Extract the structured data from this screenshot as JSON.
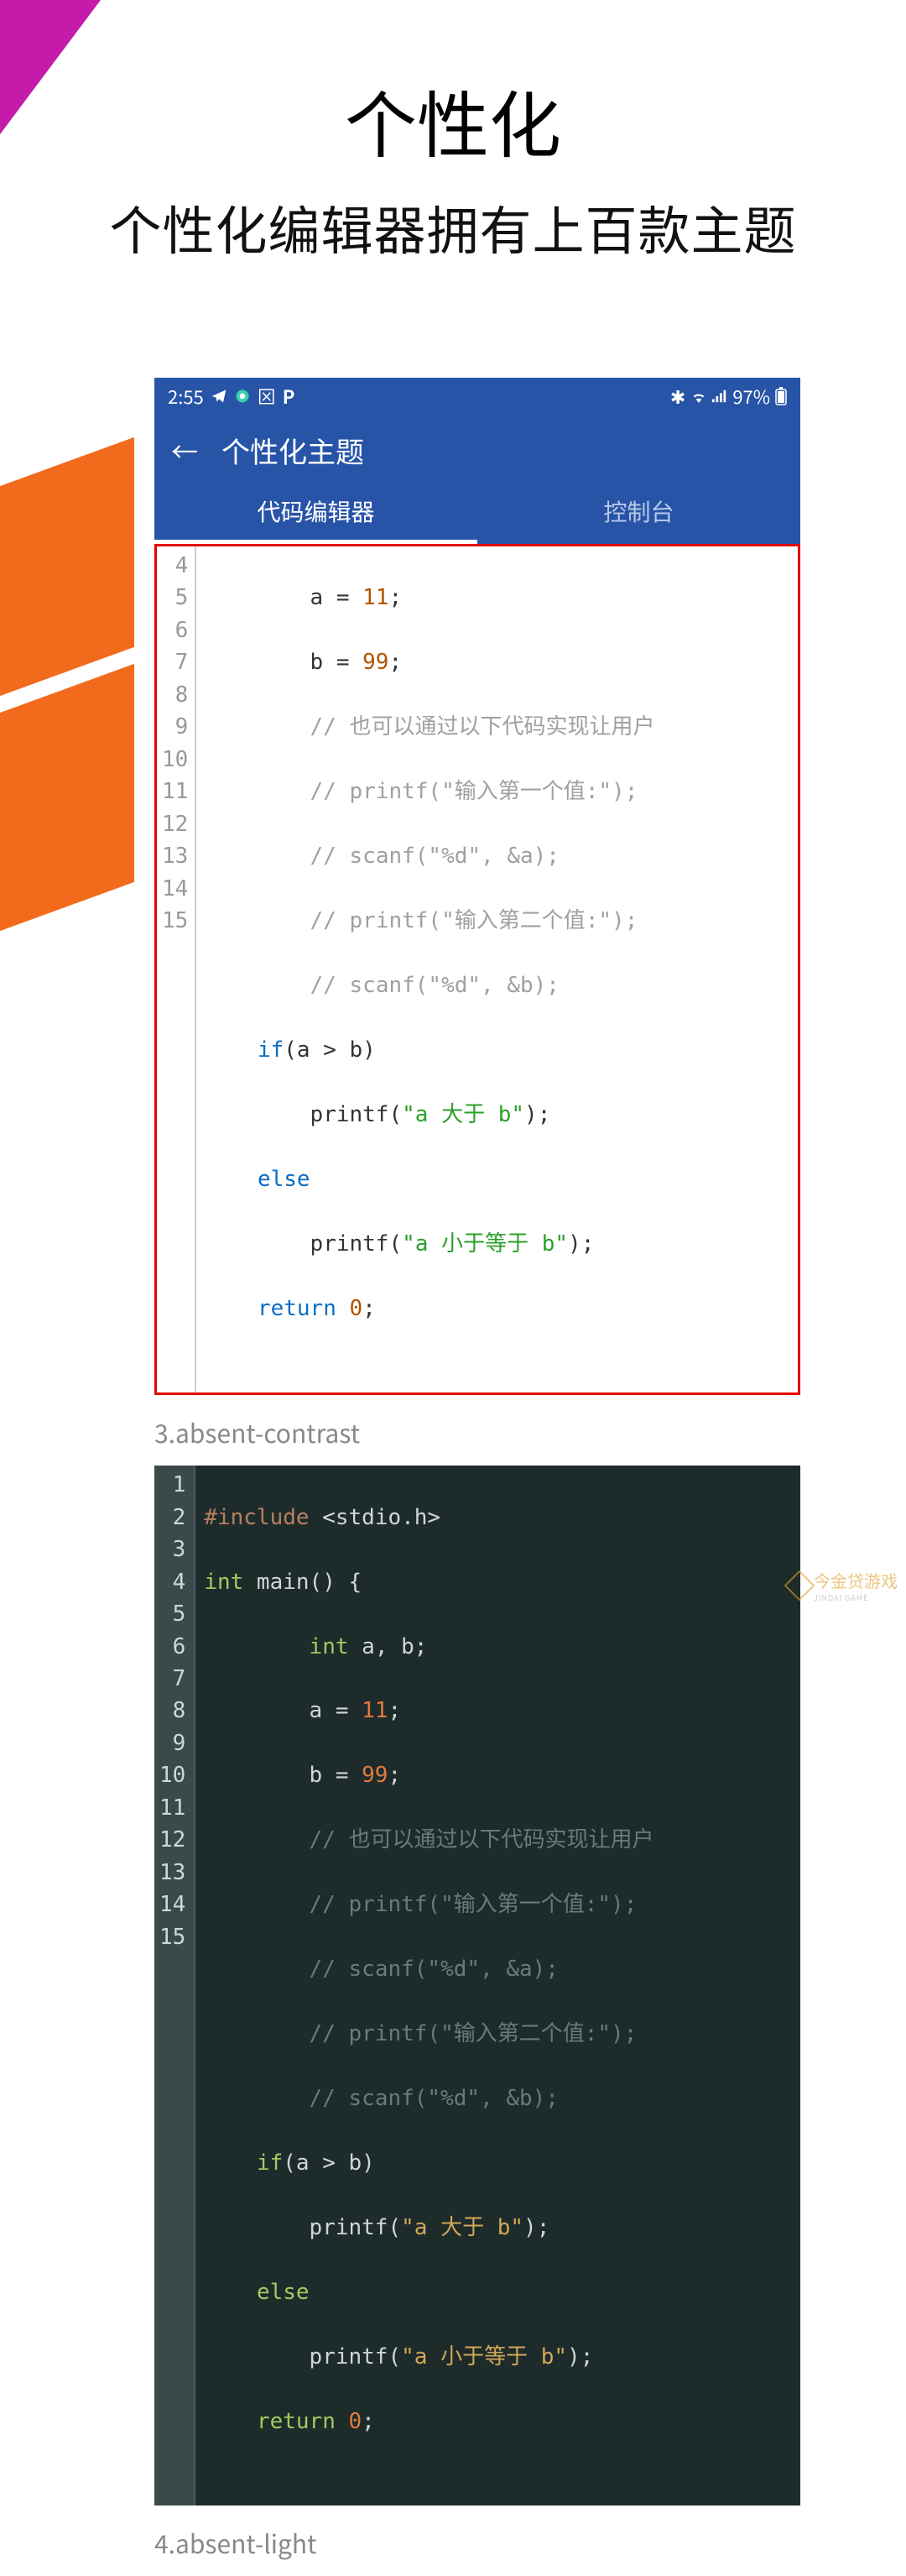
{
  "heading": {
    "title": "个性化",
    "subtitle": "个性化编辑器拥有上百款主题"
  },
  "statusbar": {
    "time": "2:55",
    "battery": "97%"
  },
  "appbar": {
    "title": "个性化主题"
  },
  "tabs": {
    "editor": "代码编辑器",
    "console": "控制台"
  },
  "lightCode": {
    "lines": [
      "4",
      "5",
      "6",
      "7",
      "8",
      "9",
      "10",
      "11",
      "12",
      "13",
      "14",
      "15"
    ],
    "l4_frag": "a = 11;",
    "l5": "    b = 99;",
    "l6": "    // 也可以通过以下代码实现让用户",
    "l7": "    // printf(\"输入第一个值:\");",
    "l8": "    // scanf(\"%d\", &a);",
    "l9": "    // printf(\"输入第二个值:\");",
    "l10": "    // scanf(\"%d\", &b);",
    "l11": "if(a > b)",
    "l12": "    printf(\"a 大于 b\");",
    "l13": "else",
    "l14": "    printf(\"a 小于等于 b\");",
    "l15": "return 0;"
  },
  "theme3": "3.absent-contrast",
  "darkCode": {
    "lines": [
      "1",
      "2",
      "3",
      "4",
      "5",
      "6",
      "7",
      "8",
      "9",
      "10",
      "11",
      "12",
      "13",
      "14",
      "15"
    ],
    "l1": "#include <stdio.h>",
    "l2": "int main() {",
    "l3": "    int a, b;",
    "l4": "    a = 11;",
    "l5": "    b = 99;",
    "l6": "    // 也可以通过以下代码实现让用户",
    "l7": "    // printf(\"输入第一个值:\");",
    "l8": "    // scanf(\"%d\", &a);",
    "l9": "    // printf(\"输入第二个值:\");",
    "l10": "    // scanf(\"%d\", &b);",
    "l11": "if(a > b)",
    "l12": "    printf(\"a 大于 b\");",
    "l13": "else",
    "l14": "    printf(\"a 小于等于 b\");",
    "l15": "return 0;"
  },
  "theme4": "4.absent-light",
  "watermark": {
    "text": "今金贷游戏",
    "sub": "JINDAI GAME"
  }
}
